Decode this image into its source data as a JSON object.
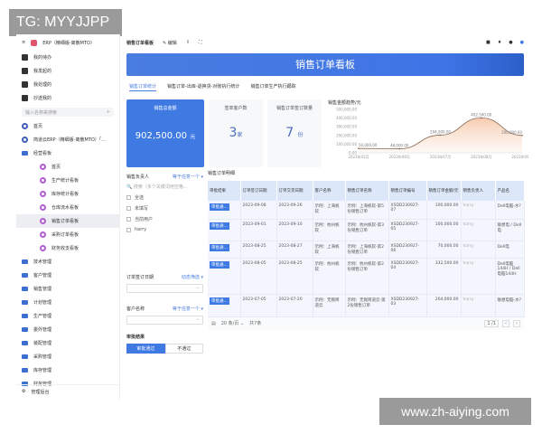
{
  "watermarks": {
    "top_left": "TG: MYYJJPP",
    "bottom_right": "www.zh-aiying.com"
  },
  "sidebar": {
    "app_title": "ERP（精细版-离散MTO）",
    "quick": [
      {
        "label": "我的待办",
        "icon": "bell-icon"
      },
      {
        "label": "我发起的",
        "icon": "send-icon"
      },
      {
        "label": "我处理的",
        "icon": "inbox-icon"
      },
      {
        "label": "抄送我的",
        "icon": "paper-plane-icon"
      }
    ],
    "search_placeholder": "输入名称来搜索",
    "items": [
      {
        "label": "首页",
        "type": "b"
      },
      {
        "label": "简道云ERP（精细版-离散MTO）「...",
        "type": "b"
      },
      {
        "label": "经营看板",
        "type": "f"
      }
    ],
    "subitems": [
      "首页",
      "生产统计看板",
      "库存统计看板",
      "仓库流水看板",
      "销售订单看板",
      "采购订单看板",
      "财务收支看板"
    ],
    "active": "销售订单看板",
    "folders": [
      "技术管理",
      "客户管理",
      "销售管理",
      "计划管理",
      "生产管理",
      "委外管理",
      "装配管理",
      "采购管理",
      "库存管理",
      "财务管理"
    ],
    "footer": "管理后台"
  },
  "topbar": {
    "title": "销售订单看板",
    "edit": "编辑"
  },
  "banner": "销售订单看板",
  "tabs": [
    "销售订单统计",
    "销售订单-出库-退换货-对账执行统计",
    "销售订单生产执行跟踪"
  ],
  "cards": [
    {
      "title": "销售总金额",
      "value": "902,500.00",
      "unit": "元"
    },
    {
      "title": "签单客户数",
      "value": "3",
      "unit": "家"
    },
    {
      "title": "销售订单签订数量",
      "value": "7",
      "unit": "份"
    }
  ],
  "chart_data": {
    "type": "area",
    "title": "销售金额趋势/元",
    "categories": [
      "2023年05月",
      "2023年06月",
      "2023年07月",
      "2023年08月",
      "2023年09月"
    ],
    "values": [
      50000,
      46000,
      204000,
      402500,
      200000
    ],
    "labels": [
      "50,000.00",
      "46,000.00",
      "204,000.00",
      "402,500.00",
      "200,000.00"
    ],
    "ylim": [
      0,
      500000
    ],
    "yticks": [
      "0.00",
      "100,000.00",
      "200,000.00",
      "300,000.00",
      "400,000.00",
      "500,000.00"
    ],
    "color": "#e8a27a"
  },
  "filter": {
    "owner_label": "销售负责人",
    "owner_mode": "等于任意一个",
    "owner_search": "搜索（多个关键词用空格...",
    "options": [
      "全选",
      "未填写",
      "当前用户",
      "harry"
    ],
    "date_label": "订单签订日期",
    "date_mode": "动态筛选",
    "customer_label": "客户名称",
    "customer_mode": "等于任意一个",
    "approve_label": "审批结果",
    "approve_buttons": [
      "审批通过",
      "不通过"
    ]
  },
  "table": {
    "caption": "销售订单明细",
    "headers": [
      "审批结果",
      "订单签订日期",
      "订单交货日期",
      "客户名称",
      "销售订单名称",
      "销售订单编号",
      "销售订单金额/元",
      "销售负责人",
      "产品名"
    ],
    "rows": [
      [
        "审批通...",
        "2023-09-08",
        "2023-09-26",
        "示例：上海帆软",
        "示例：上海帆软-第5份销售订单",
        "XSDD230927-07",
        "100,000.00",
        "harry",
        "Dell电脑-水?"
      ],
      [
        "审批通...",
        "2023-09-01",
        "2023-09-10",
        "示例：杭州帆软",
        "示例：杭州帆软-第3份销售订单",
        "XSDD230927-05",
        "100,000.00",
        "harry",
        "联想电 / Dell电"
      ],
      [
        "审批通...",
        "2023-08-25",
        "2023-08-27",
        "示例：上海帆软",
        "示例：上海帆软-第2份销售订单",
        "XSDD230927-06",
        "70,000.00",
        "harry",
        "Dell电"
      ],
      [
        "审批通...",
        "2023-08-05",
        "2023-08-25",
        "示例：杭州帆软",
        "示例：杭州帆软-第2份销售订单",
        "XSDD230927-04",
        "332,500.00",
        "harry",
        "Dell电脑144H / Dell电脑144H"
      ],
      [
        "审批通...",
        "2023-07-05",
        "2023-07-20",
        "示例：无锡简道云",
        "示例：无锡简道云-第2份销售订单",
        "XSDD230927-03",
        "204,000.00",
        "harry",
        "联想电脑-水?"
      ]
    ],
    "page_size": "20 条/页",
    "total": "共7条",
    "page": "1 /1"
  }
}
